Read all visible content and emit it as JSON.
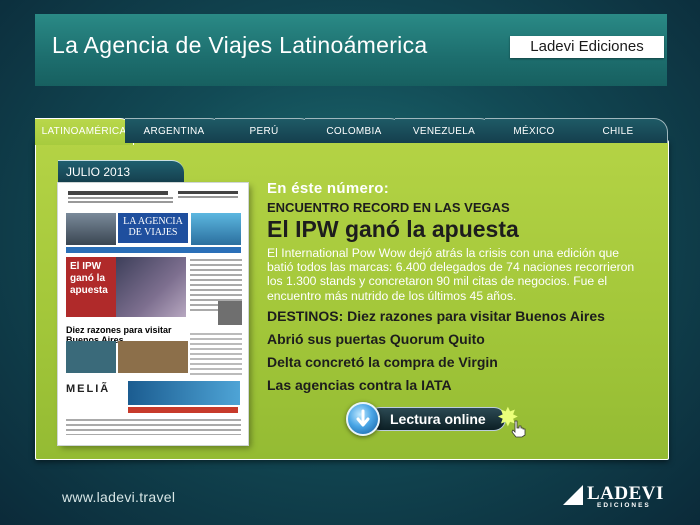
{
  "header": {
    "title": "La Agencia de Viajes Latinoámerica",
    "brand": "Ladevi Ediciones"
  },
  "tabs": [
    {
      "label": "LATINOAMÉRICA",
      "active": true
    },
    {
      "label": "ARGENTINA",
      "active": false
    },
    {
      "label": "PERÚ",
      "active": false
    },
    {
      "label": "COLOMBIA",
      "active": false
    },
    {
      "label": "VENEZUELA",
      "active": false
    },
    {
      "label": "MÉXICO",
      "active": false
    },
    {
      "label": "CHILE",
      "active": false
    }
  ],
  "issue": {
    "date": "JULIO 2013",
    "cover": {
      "masthead": "LA AGENCIA DE VIAJES",
      "hero_headline": "El IPW ganó la apuesta",
      "section_headline": "Diez razones para visitar Buenos Aires",
      "advertiser": "MELIÃ"
    }
  },
  "content": {
    "intro": "En éste número:",
    "kicker": "ENCUENTRO RECORD EN LAS VEGAS",
    "headline": "El IPW ganó la apuesta",
    "body": "El International Pow Wow dejó atrás la crisis con una edición que batió todos las marcas: 6.400 delegados de 74 naciones recorrieron los 1.300 stands y concretaron 90 mil citas de negocios. Fue el encuentro más nutrido de los últimos 45 años.",
    "links": [
      "DESTINOS: Diez razones para visitar Buenos Aires",
      "Abrió sus puertas Quorum Quito",
      "Delta concretó la compra de Virgin",
      "Las agencias contra la IATA"
    ]
  },
  "read_button": {
    "label": "Lectura online"
  },
  "footer": {
    "url": "www.ladevi.travel",
    "logo_word": "LADEVI",
    "logo_sub": "EDICIONES"
  },
  "colors": {
    "panel": "#a9cc40",
    "tab_dark": "#153f4d",
    "background": "#124a55"
  }
}
